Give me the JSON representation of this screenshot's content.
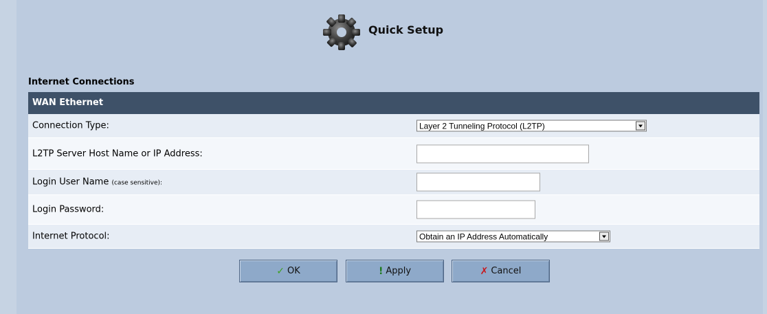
{
  "header": {
    "title": "Quick Setup",
    "icon": "gear-icon"
  },
  "section": {
    "title": "Internet Connections"
  },
  "wan": {
    "header": "WAN Ethernet",
    "rows": [
      {
        "label": "Connection Type:",
        "control": "select",
        "value": "Layer 2 Tunneling Protocol (L2TP)"
      },
      {
        "label": "L2TP Server Host Name or IP Address:",
        "control": "input",
        "value": ""
      },
      {
        "label": "Login User Name",
        "label_note": "(case sensitive):",
        "control": "input",
        "value": ""
      },
      {
        "label": "Login Password:",
        "control": "input",
        "value": ""
      },
      {
        "label": "Internet Protocol:",
        "control": "select",
        "value": "Obtain an IP Address Automatically"
      }
    ]
  },
  "buttons": {
    "ok": {
      "label": "OK",
      "icon": "checkmark-icon",
      "glyph": "✓"
    },
    "apply": {
      "label": "Apply",
      "icon": "exclamation-icon",
      "glyph": "!"
    },
    "cancel": {
      "label": "Cancel",
      "icon": "x-icon",
      "glyph": "✗"
    }
  },
  "colors": {
    "background": "#c6d3e3",
    "panel": "#bccbdf",
    "wan_header": "#3e5168",
    "row_light": "#f4f7fb",
    "row_dark": "#e7edf5",
    "button": "#8ea9c9"
  }
}
